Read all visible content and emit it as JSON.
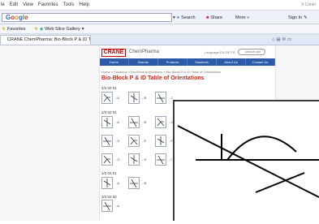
{
  "menu": {
    "items": [
      "le",
      "Edit",
      "View",
      "Favorites",
      "Tools",
      "Help"
    ],
    "right_hint": "X Contri"
  },
  "toolbar": {
    "google_letters": [
      "G",
      "o",
      "o",
      "g",
      "l",
      "e"
    ],
    "search_label": "Search",
    "share_label": "Share",
    "more_label": "More »",
    "signin_label": "Sign In"
  },
  "favorites_bar": {
    "favorites_label": "Favorites",
    "gallery_label": "Web Slice Gallery"
  },
  "tab": {
    "title": "CRANE ChemPharma: Bio-Block P & ID Table of ..."
  },
  "site": {
    "logo_text": "CRANE",
    "brand_text": "ChemPharma",
    "language_label": "Language EN DE FR",
    "search_placeholder": "search site",
    "nav": [
      "Home",
      "Brands",
      "Products",
      "Solutions",
      "About Us",
      "Contact Us"
    ],
    "breadcrumb": "Home » Solutions » Bio-Block Applications » Bio-Block P & ID Table of Orientations",
    "page_title": "Bio-Block P & ID Table of Orientations",
    "sections": [
      {
        "label": "2/2 02 01",
        "items": [
          "A",
          "B",
          "C"
        ]
      },
      {
        "label": "2/3 02 01",
        "items": [
          "A",
          "B",
          "C",
          "D",
          "E",
          "F",
          "G",
          "H",
          "I"
        ]
      },
      {
        "label": "2/3 04 01",
        "items": [
          "A",
          "B"
        ]
      },
      {
        "label": "3/4 02 02",
        "items": [
          "A"
        ]
      }
    ]
  }
}
